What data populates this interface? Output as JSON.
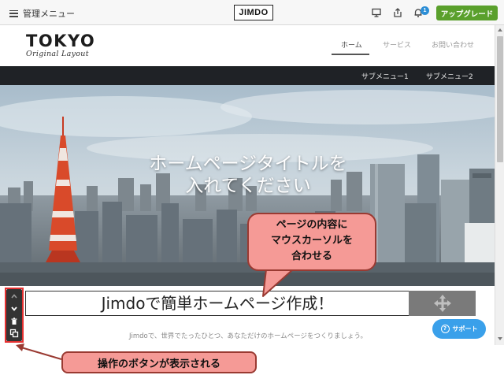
{
  "admin_bar": {
    "menu_label": "管理メニュー",
    "logo": "JIMDO",
    "notification_count": "1",
    "upgrade_label": "アップグレード",
    "icons": [
      "hamburger-icon",
      "desktop-preview-icon",
      "share-icon",
      "bell-icon"
    ]
  },
  "site": {
    "brand": "TOKYO",
    "brand_sub": "Original Layout",
    "nav": [
      "ホーム",
      "サービス",
      "お問い合わせ"
    ],
    "active_nav": "ホーム",
    "sub_nav": [
      "サブメニュー1",
      "サブメニュー2"
    ]
  },
  "hero": {
    "title_line1": "ホームページタイトルを",
    "title_line2": "入れてください"
  },
  "content": {
    "section_title": "Jimdoで簡単ホームページ作成！",
    "tagline": "Jimdoで、世界でたったひとつ、あなただけのホームページをつくりましょう。"
  },
  "tools": [
    "chevron-up-icon",
    "chevron-down-icon",
    "trash-icon",
    "copy-icon",
    "move-arrows-icon"
  ],
  "support": {
    "label": "サポート"
  },
  "annotations": {
    "main_line1": "ページの内容に",
    "main_line2": "マウスカーソルを",
    "main_line3": "合わせる",
    "bottom": "操作のボタンが表示される"
  },
  "colors": {
    "upgrade": "#5aa02c",
    "sub_nav_bg": "#1f2226",
    "support": "#3aa0ea",
    "callout_fill": "#f59a96",
    "callout_border": "#9a3a32",
    "highlight": "#e53030"
  }
}
